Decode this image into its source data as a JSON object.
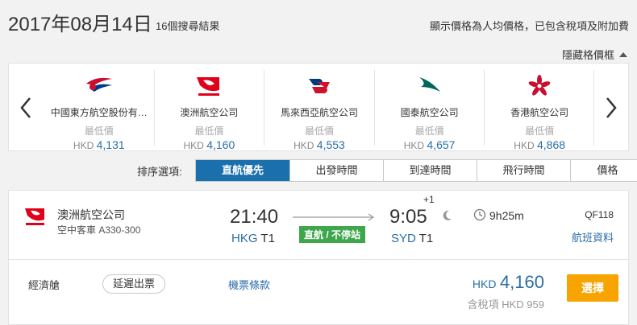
{
  "header": {
    "date": "2017年08月14日",
    "result_count": "16個搜尋結果",
    "price_note": "顯示價格為人均價格，已包含稅項及附加費"
  },
  "hide_grid_label": "隱藏格價框",
  "carousel": {
    "airlines": [
      {
        "name": "中國東方航空股份有…",
        "low_label": "最低價",
        "currency": "HKD",
        "price": "4,131",
        "logo": "china-eastern-logo-icon"
      },
      {
        "name": "澳洲航空公司",
        "low_label": "最低價",
        "currency": "HKD",
        "price": "4,160",
        "logo": "qantas-logo-icon"
      },
      {
        "name": "馬來西亞航空公司",
        "low_label": "最低價",
        "currency": "HKD",
        "price": "4,553",
        "logo": "malaysia-airlines-logo-icon"
      },
      {
        "name": "國泰航空公司",
        "low_label": "最低價",
        "currency": "HKD",
        "price": "4,657",
        "logo": "cathay-pacific-logo-icon"
      },
      {
        "name": "香港航空公司",
        "low_label": "最低價",
        "currency": "HKD",
        "price": "4,868",
        "logo": "hong-kong-airlines-logo-icon"
      }
    ]
  },
  "sort": {
    "label": "排序選項:",
    "tabs": [
      {
        "label": "直航優先",
        "active": true
      },
      {
        "label": "出發時間",
        "active": false
      },
      {
        "label": "到達時間",
        "active": false
      },
      {
        "label": "飛行時間",
        "active": false
      },
      {
        "label": "價格",
        "active": false
      }
    ]
  },
  "flight": {
    "airline": "澳洲航空公司",
    "aircraft": "空中客車 A330-300",
    "dep_time": "21:40",
    "dep_airport": "HKG",
    "dep_terminal": "T1",
    "nonstop": "直航 / 不停站",
    "arr_time": "9:05",
    "arr_plus": "+1",
    "arr_airport": "SYD",
    "arr_terminal": "T1",
    "duration": "9h25m",
    "flight_no": "QF118",
    "details_link": "航班資料"
  },
  "fare": {
    "cabin": "經濟艙",
    "delay_ticket": "延遲出票",
    "terms": "機票條款",
    "currency": "HKD",
    "amount": "4,160",
    "tax_label": "含稅項",
    "tax_currency": "HKD",
    "tax_amount": "959",
    "select": "選擇"
  },
  "colors": {
    "accent_blue": "#1a6fad",
    "link_blue": "#2a6ea8",
    "nonstop_green": "#3ea64b",
    "select_orange": "#f7a400"
  }
}
